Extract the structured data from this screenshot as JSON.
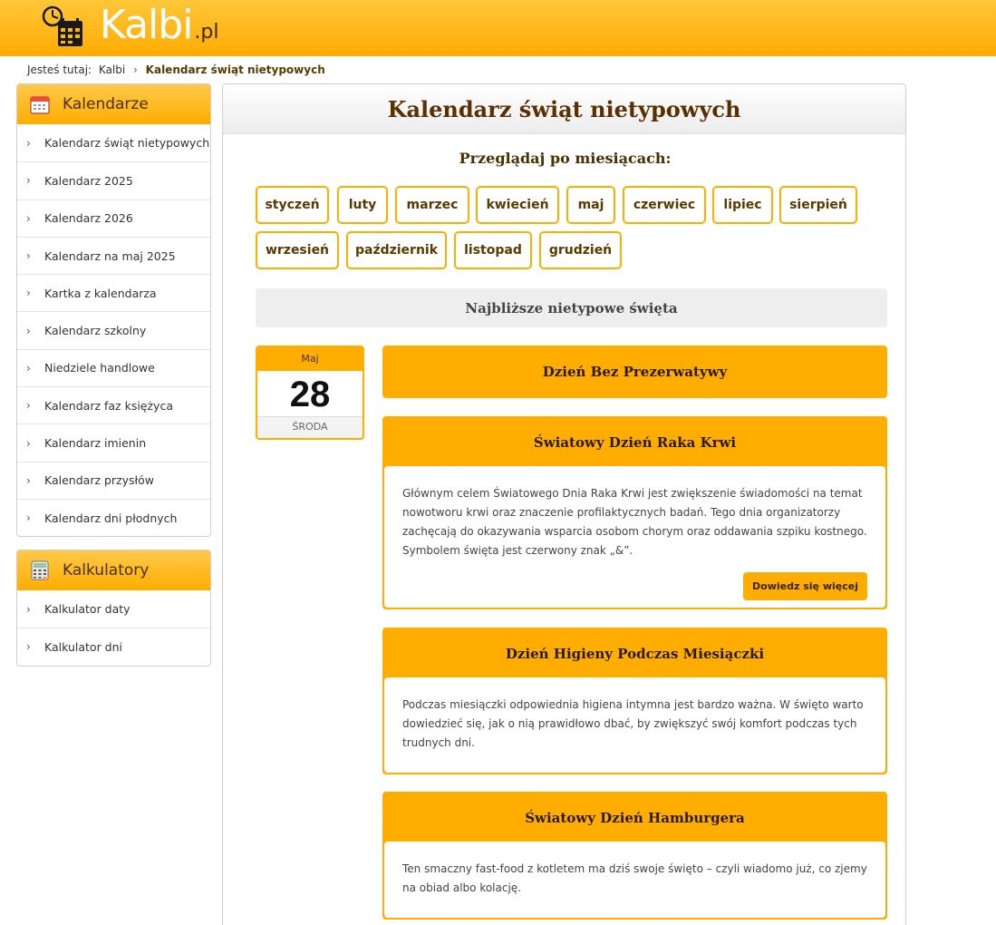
{
  "header": {
    "logo_main": "Kalbi",
    "logo_suffix": ".pl"
  },
  "breadcrumb": {
    "prefix": "Jesteś tutaj:",
    "home": "Kalbi",
    "separator": "›",
    "current": "Kalendarz świąt nietypowych"
  },
  "sidebar": {
    "calendars": {
      "title": "Kalendarze",
      "items": [
        "Kalendarz świąt nietypowych",
        "Kalendarz 2025",
        "Kalendarz 2026",
        "Kalendarz na maj 2025",
        "Kartka z kalendarza",
        "Kalendarz szkolny",
        "Niedziele handlowe",
        "Kalendarz faz księżyca",
        "Kalendarz imienin",
        "Kalendarz przysłów",
        "Kalendarz dni płodnych"
      ]
    },
    "calculators": {
      "title": "Kalkulatory",
      "items": [
        "Kalkulator daty",
        "Kalkulator dni"
      ]
    },
    "chevron": "›"
  },
  "main": {
    "title": "Kalendarz świąt nietypowych",
    "browse_label": "Przeglądaj po miesiącach:",
    "months": [
      "styczeń",
      "luty",
      "marzec",
      "kwiecień",
      "maj",
      "czerwiec",
      "lipiec",
      "sierpień",
      "wrzesień",
      "październik",
      "listopad",
      "grudzień"
    ],
    "nearest_label": "Najbliższe nietypowe święta",
    "date": {
      "month": "Maj",
      "day": "28",
      "weekday": "ŚRODA"
    },
    "holidays": [
      {
        "title": "Dzień Bez Prezerwatywy"
      },
      {
        "title": "Światowy Dzień Raka Krwi",
        "text": "Głównym celem Światowego Dnia Raka Krwi jest zwiększenie świadomości na temat nowotworu krwi oraz znaczenie profilaktycznych badań. Tego dnia organizatorzy zachęcają do okazywania wsparcia osobom chorym oraz oddawania szpiku kostnego. Symbolem święta jest czerwony znak „&”.",
        "more": "Dowiedz się więcej"
      },
      {
        "title": "Dzień Higieny Podczas Miesiączki",
        "text": "Podczas miesiączki odpowiednia higiena intymna jest bardzo ważna. W święto warto dowiedzieć się, jak o nią prawidłowo dbać, by zwiększyć swój komfort podczas tych trudnych dni."
      },
      {
        "title": "Światowy Dzień Hamburgera",
        "text": "Ten smaczny fast-food z kotletem ma dziś swoje święto – czyli wiadomo już, co zjemy na obiad albo kolację."
      }
    ]
  },
  "colors": {
    "accent": "#ffad00",
    "brown": "#5b3a00"
  }
}
